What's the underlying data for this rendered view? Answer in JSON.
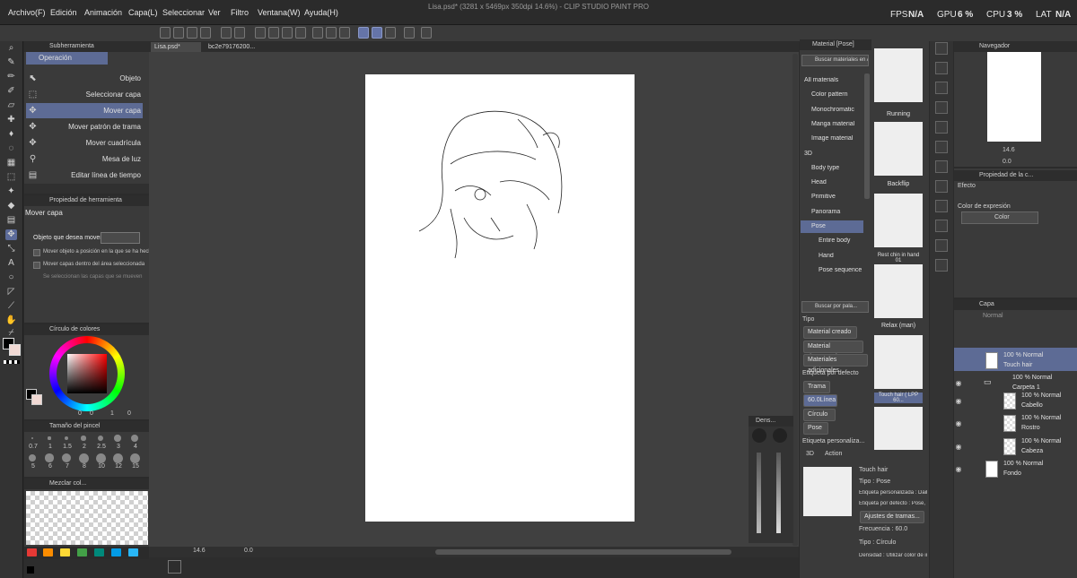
{
  "menu": [
    "Archivo(F)",
    "Edición",
    "Animación",
    "Capa(L)",
    "Seleccionar",
    "Ver",
    "Filtro",
    "Ventana(W)",
    "Ayuda(H)"
  ],
  "window_title": "Lisa.psd* (3281 x 5469px 350dpi 14.6%) - CLIP STUDIO PAINT PRO",
  "stats": {
    "fps_label": "FPS",
    "fps": "N/A",
    "gpu_label": "GPU",
    "gpu": "6 %",
    "cpu_label": "CPU",
    "cpu": "3 %",
    "lat_label": "LAT",
    "lat": "N/A"
  },
  "doc_tabs": [
    "Lisa.psd*",
    "bc2e79176200..."
  ],
  "subtool": {
    "header": "Subherramienta",
    "group": "Operación",
    "items": [
      "Objeto",
      "Seleccionar capa",
      "Mover capa",
      "Mover patrón de trama",
      "Mover cuadrícula",
      "Mesa de luz",
      "Editar línea de tiempo"
    ],
    "selected": 2
  },
  "tool_property": {
    "header": "Propiedad de herramienta",
    "name": "Mover capa",
    "target_label": "Objeto que desea mover",
    "options": [
      "Mover objeto a posición en la que se ha hecho ...",
      "Mover capas dentro del área seleccionada",
      "Se seleccionan las capas que se mueven"
    ]
  },
  "color_wheel": {
    "header": "Círculo de colores",
    "v1": "0",
    "v2": "0",
    "v3": "1",
    "v4": "0",
    "v5": "0"
  },
  "brush_size": {
    "header": "Tamaño del pincel",
    "row1": [
      "0.7",
      "1",
      "1.5",
      "2",
      "2.5",
      "3",
      "4"
    ],
    "row2": [
      "5",
      "6",
      "7",
      "8",
      "10",
      "12",
      "15"
    ]
  },
  "mix": {
    "header": "Mezclar col..."
  },
  "status": {
    "zoom": "14.6",
    "angle": "0.0"
  },
  "material": {
    "header": "Material [Pose]",
    "search": "Buscar materiales en ASS...",
    "tree": [
      "All materials",
      "Color pattern",
      "Monochromatic",
      "Manga material",
      "Image material",
      "3D",
      "Body type",
      "Head",
      "Primitive",
      "Panorama",
      "Pose",
      "Entire body",
      "Hand",
      "Pose sequence"
    ],
    "search2": "Buscar por pala...",
    "tipo_label": "Tipo",
    "tipo": [
      "Material creado",
      "Material descargado",
      "Materiales adicionales"
    ],
    "etiqueta_label": "Etiqueta por defecto",
    "etiquetas": [
      "Trama",
      "60.0Línea",
      "Círculo",
      "Pose"
    ],
    "etiqueta_pers": "Etiqueta personaliza...",
    "tabs": [
      "3D",
      "Action"
    ],
    "items": [
      "Running",
      "Backflip",
      "Rest chin in hand 01",
      "Relax (man)",
      "Touch hair ( LPP 60..."
    ],
    "detail": {
      "name": "Touch hair",
      "tipo": "Tipo : Pose",
      "et_pers": "Etiqueta personalizada : Daily_beh...",
      "et_def": "Etiqueta por defecto : Pose, Trama...",
      "ajustes": "Ajustes de tramas...",
      "frecuencia": "Frecuencia : 60.0",
      "tipo2": "Tipo : Círculo",
      "densidad": "Densidad : Utilizar color de imagen"
    }
  },
  "navigator": {
    "header": "Navegador",
    "zoom": "14.6",
    "angle": "0.0"
  },
  "layer_property": {
    "header": "Propiedad de la c...",
    "efecto": "Efecto",
    "color_expr": "Color de expresión",
    "color": "Color"
  },
  "layers": {
    "header": "Capa",
    "blend": "Normal",
    "items": [
      {
        "pct": "100 % Normal",
        "name": "Touch hair"
      },
      {
        "pct": "100 % Normal",
        "name": "Carpeta 1"
      },
      {
        "pct": "100 % Normal",
        "name": "Cabello"
      },
      {
        "pct": "100 % Normal",
        "name": "Rostro"
      },
      {
        "pct": "100 % Normal",
        "name": "Cabeza"
      },
      {
        "pct": "100 % Normal",
        "name": "Fondo"
      }
    ]
  },
  "brush_panel": {
    "header": "Dens..."
  },
  "colors": {
    "accent": "#5d6b95",
    "bg": "#3a3a3a",
    "dark": "#2b2b2b"
  }
}
